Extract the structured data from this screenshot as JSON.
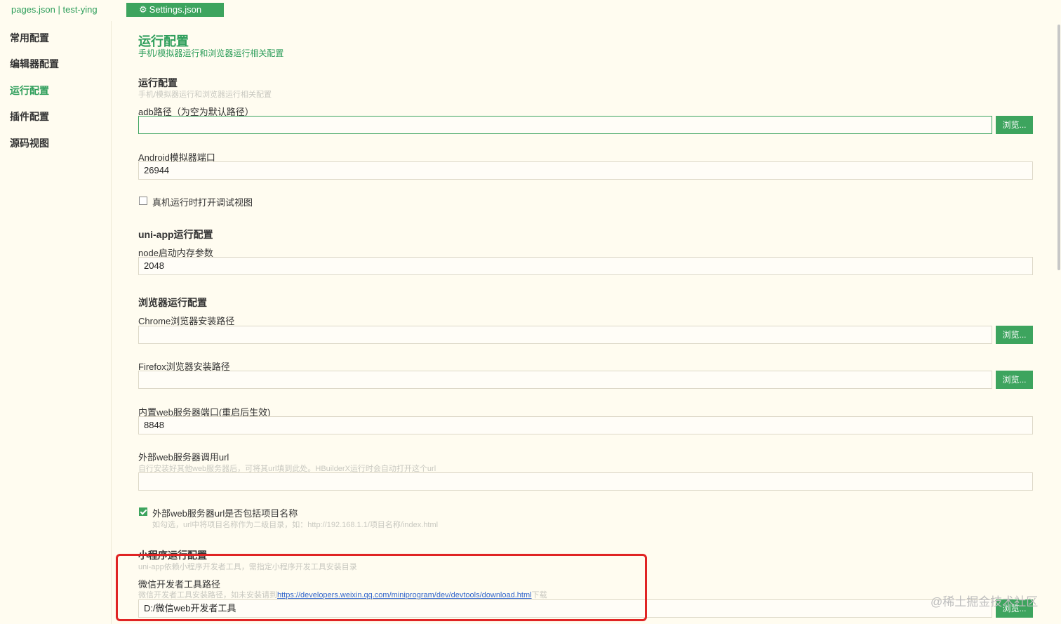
{
  "tabs": {
    "pages": "pages.json | test-ying",
    "settings": "Settings.json",
    "settings_icon": "gear-icon"
  },
  "sidebar": {
    "items": [
      {
        "label": "常用配置",
        "active": false
      },
      {
        "label": "编辑器配置",
        "active": false
      },
      {
        "label": "运行配置",
        "active": true
      },
      {
        "label": "插件配置",
        "active": false
      },
      {
        "label": "源码视图",
        "active": false
      }
    ]
  },
  "page": {
    "title": "运行配置",
    "subtitle": "手机/模拟器运行和浏览器运行相关配置"
  },
  "run": {
    "heading": "运行配置",
    "desc": "手机/模拟器运行和浏览器运行相关配置",
    "adb_label": "adb路径（为空为默认路径）",
    "adb_value": "",
    "android_port_label": "Android模拟器端口",
    "android_port_value": "26944",
    "debug_view_label": "真机运行时打开调试视图",
    "debug_view_checked": false
  },
  "uniapp": {
    "heading": "uni-app运行配置",
    "node_mem_label": "node启动内存参数",
    "node_mem_value": "2048"
  },
  "browser": {
    "heading": "浏览器运行配置",
    "chrome_label": "Chrome浏览器安装路径",
    "chrome_value": "",
    "firefox_label": "Firefox浏览器安装路径",
    "firefox_value": "",
    "web_port_label": "内置web服务器端口(重启后生效)",
    "web_port_value": "8848",
    "ext_url_label": "外部web服务器调用url",
    "ext_url_desc": "自行安装好其他web服务器后，可将其url填到此处。HBuilderX运行时会自动打开这个url",
    "ext_url_value": "",
    "include_name_label": "外部web服务器url是否包括项目名称",
    "include_name_desc": "如勾选，url中将项目名称作为二级目录，如：http://192.168.1.1/项目名称/index.html",
    "include_name_checked": true
  },
  "mini": {
    "heading": "小程序运行配置",
    "desc": "uni-app依赖小程序开发者工具，需指定小程序开发工具安装目录",
    "wechat_label": "微信开发者工具路径",
    "wechat_desc_prefix": "微信开发者工具安装路径，如未安装请到",
    "wechat_link": "https://developers.weixin.qq.com/miniprogram/dev/devtools/download.html",
    "wechat_desc_suffix": "下载",
    "wechat_value": "D:/微信web开发者工具"
  },
  "browse_label": "浏览...",
  "watermark": "@稀土掘金技术社区",
  "colors": {
    "accent": "#3da45e",
    "background": "#fffcf0",
    "highlight_box": "#e02424"
  }
}
